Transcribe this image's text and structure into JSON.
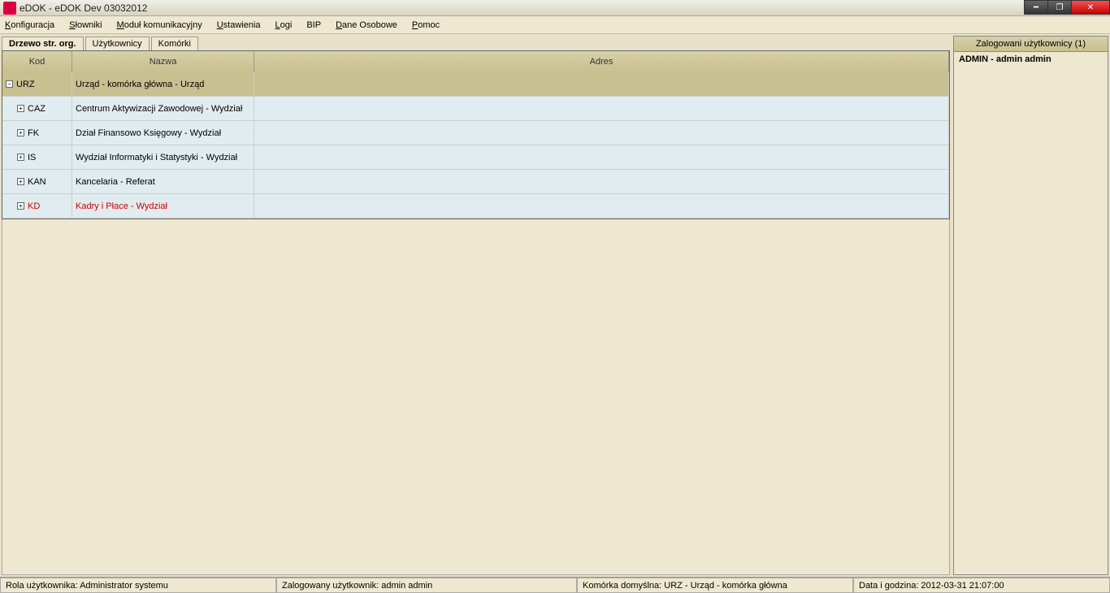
{
  "window": {
    "title": "eDOK - eDOK Dev 03032012"
  },
  "menu": {
    "items": [
      {
        "label": "Konfiguracja",
        "u": "K"
      },
      {
        "label": "Słowniki",
        "u": "S"
      },
      {
        "label": "Moduł komunikacyjny",
        "u": "M"
      },
      {
        "label": "Ustawienia",
        "u": "U"
      },
      {
        "label": "Logi",
        "u": "L"
      },
      {
        "label": "BIP",
        "u": ""
      },
      {
        "label": "Dane Osobowe",
        "u": "D"
      },
      {
        "label": "Pomoc",
        "u": "P"
      }
    ]
  },
  "tabs": {
    "items": [
      {
        "label": "Drzewo str. org.",
        "active": true
      },
      {
        "label": "Użytkownicy",
        "active": false
      },
      {
        "label": "Komórki",
        "active": false
      }
    ]
  },
  "grid": {
    "headers": {
      "kod": "Kod",
      "nazwa": "Nazwa",
      "adres": "Adres"
    },
    "rows": [
      {
        "level": 0,
        "expanded": true,
        "kod": "URZ",
        "nazwa": "Urząd - komórka główna - Urząd",
        "adres": "",
        "highlight": false
      },
      {
        "level": 1,
        "expanded": false,
        "kod": "CAZ",
        "nazwa": "Centrum Aktywizacji Zawodowej - Wydział",
        "adres": "",
        "highlight": false
      },
      {
        "level": 1,
        "expanded": false,
        "kod": "FK",
        "nazwa": "Dział Finansowo Księgowy - Wydział",
        "adres": "",
        "highlight": false
      },
      {
        "level": 1,
        "expanded": false,
        "kod": "IS",
        "nazwa": "Wydział Informatyki i Statystyki - Wydział",
        "adres": "",
        "highlight": false
      },
      {
        "level": 1,
        "expanded": false,
        "kod": "KAN",
        "nazwa": "Kancelaria - Referat",
        "adres": "",
        "highlight": false
      },
      {
        "level": 1,
        "expanded": false,
        "kod": "KD",
        "nazwa": "Kadry i Płace - Wydział",
        "adres": "",
        "highlight": true
      }
    ]
  },
  "sidepanel": {
    "header": "Zalogowani użytkownicy (1)",
    "user": "ADMIN - admin admin"
  },
  "statusbar": {
    "role": "Rola użytkownika: Administrator systemu",
    "logged": "Zalogowany użytkownik: admin admin",
    "unit": "Komórka domyślna: URZ - Urząd - komórka główna",
    "datetime": "Data i godzina: 2012-03-31 21:07:00"
  }
}
